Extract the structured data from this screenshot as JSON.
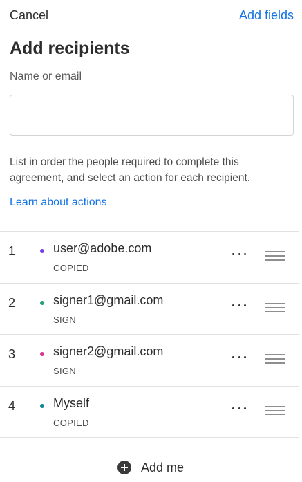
{
  "header": {
    "cancel_label": "Cancel",
    "add_fields_label": "Add fields"
  },
  "title": "Add recipients",
  "name_field": {
    "label": "Name or email",
    "value": "",
    "placeholder": ""
  },
  "instructions": "List in order the people required to complete this agreement, and select an action for each recipient.",
  "learn_link": "Learn about actions",
  "recipients": [
    {
      "number": "1",
      "email": "user@adobe.com",
      "action": "COPIED",
      "dot_color": "#7b3fe4"
    },
    {
      "number": "2",
      "email": "signer1@gmail.com",
      "action": "SIGN",
      "dot_color": "#2d9d78"
    },
    {
      "number": "3",
      "email": "signer2@gmail.com",
      "action": "SIGN",
      "dot_color": "#d83790"
    },
    {
      "number": "4",
      "email": "Myself",
      "action": "COPIED",
      "dot_color": "#0f8599"
    }
  ],
  "add_me_label": "Add me",
  "colors": {
    "accent": "#1473e6",
    "text": "#2c2c2c"
  }
}
